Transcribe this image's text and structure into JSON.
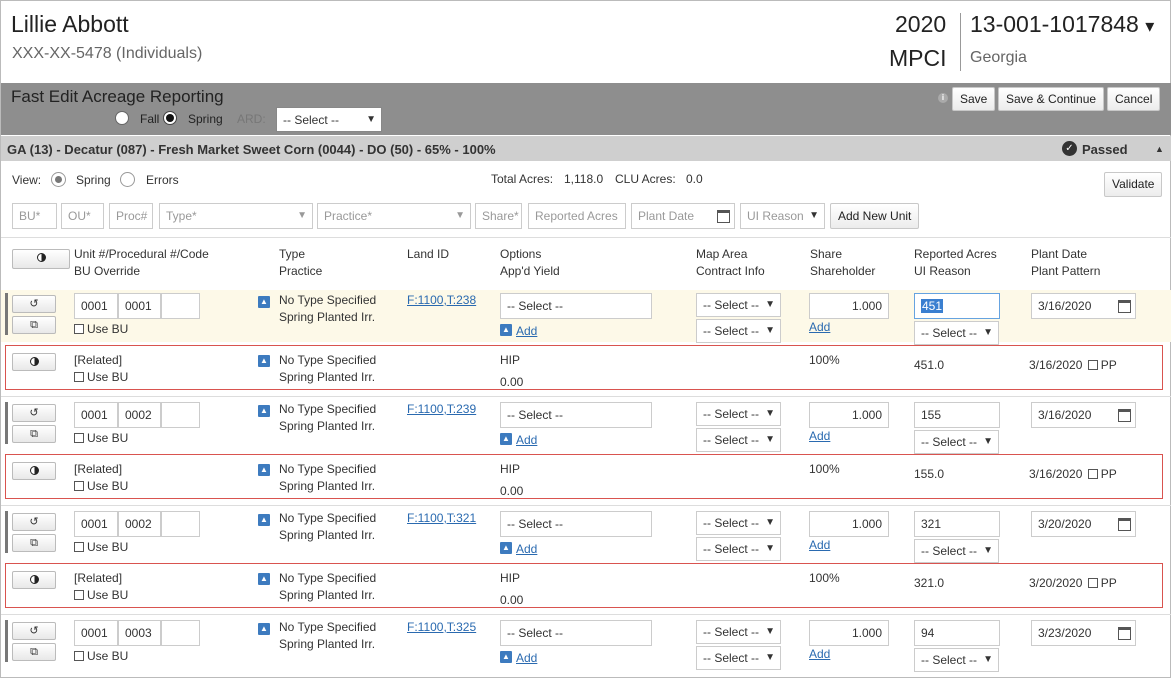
{
  "header": {
    "name": "Lillie Abbott",
    "ssn": "XXX-XX-5478 (Individuals)",
    "year": "2020",
    "policy": "13-001-1017848",
    "policy_caret": "▾",
    "plan": "MPCI",
    "state": "Georgia"
  },
  "toolbar": {
    "title": "Fast Edit Acreage Reporting",
    "fall": "Fall",
    "spring": "Spring",
    "ard": "ARD:",
    "ard_select": "-- Select --",
    "save": "Save",
    "save_continue": "Save & Continue",
    "cancel": "Cancel",
    "info": "i"
  },
  "section": {
    "title": "GA (13) - Decatur (087) - Fresh Market Sweet Corn (0044) - DO (50) - 65% - 100%",
    "status": "Passed",
    "collapse": "▲"
  },
  "view": {
    "label": "View:",
    "spring": "Spring",
    "errors": "Errors",
    "total_acres_label": "Total Acres:",
    "total_acres": "1,118.0",
    "clu_acres_label": "CLU Acres:",
    "clu_acres": "0.0",
    "validate": "Validate"
  },
  "add_row": {
    "bu": "BU*",
    "ou": "OU*",
    "proc": "Proc#",
    "type": "Type*",
    "practice": "Practice*",
    "share": "Share*",
    "reported": "Reported Acres",
    "plant_date": "Plant Date",
    "ui_reason": "UI Reason",
    "add_unit": "Add New Unit"
  },
  "columns": {
    "unit": "Unit #/Procedural #/Code",
    "bu_override": "BU Override",
    "type": "Type",
    "practice": "Practice",
    "land_id": "Land ID",
    "options": "Options",
    "appd_yield": "App'd Yield",
    "map_area": "Map Area",
    "contract": "Contract Info",
    "share": "Share",
    "shareholder": "Shareholder",
    "reported": "Reported Acres",
    "ui_reason": "UI Reason",
    "plant_date": "Plant Date",
    "plant_pattern": "Plant Pattern"
  },
  "common": {
    "use_bu": "Use BU",
    "select": "-- Select --",
    "add": "Add",
    "related": "[Related]",
    "hip": "HIP",
    "hip_value": "0.00",
    "share_pct": "100%",
    "pp": "PP"
  },
  "units": [
    {
      "unit": "0001",
      "proc": "0001",
      "type": "No Type Specified",
      "practice": "Spring Planted Irr.",
      "land": "F:1100,T:238",
      "share": "1.000",
      "acres": "451",
      "date": "3/16/2020",
      "rel_acres": "451.0"
    },
    {
      "unit": "0001",
      "proc": "0002",
      "type": "No Type Specified",
      "practice": "Spring Planted Irr.",
      "land": "F:1100,T:239",
      "share": "1.000",
      "acres": "155",
      "date": "3/16/2020",
      "rel_acres": "155.0"
    },
    {
      "unit": "0001",
      "proc": "0002",
      "type": "No Type Specified",
      "practice": "Spring Planted Irr.",
      "land": "F:1100,T:321",
      "share": "1.000",
      "acres": "321",
      "date": "3/20/2020",
      "rel_acres": "321.0"
    },
    {
      "unit": "0001",
      "proc": "0003",
      "type": "No Type Specified",
      "practice": "Spring Planted Irr.",
      "land": "F:1100,T:325",
      "share": "1.000",
      "acres": "94",
      "date": "3/23/2020"
    }
  ]
}
